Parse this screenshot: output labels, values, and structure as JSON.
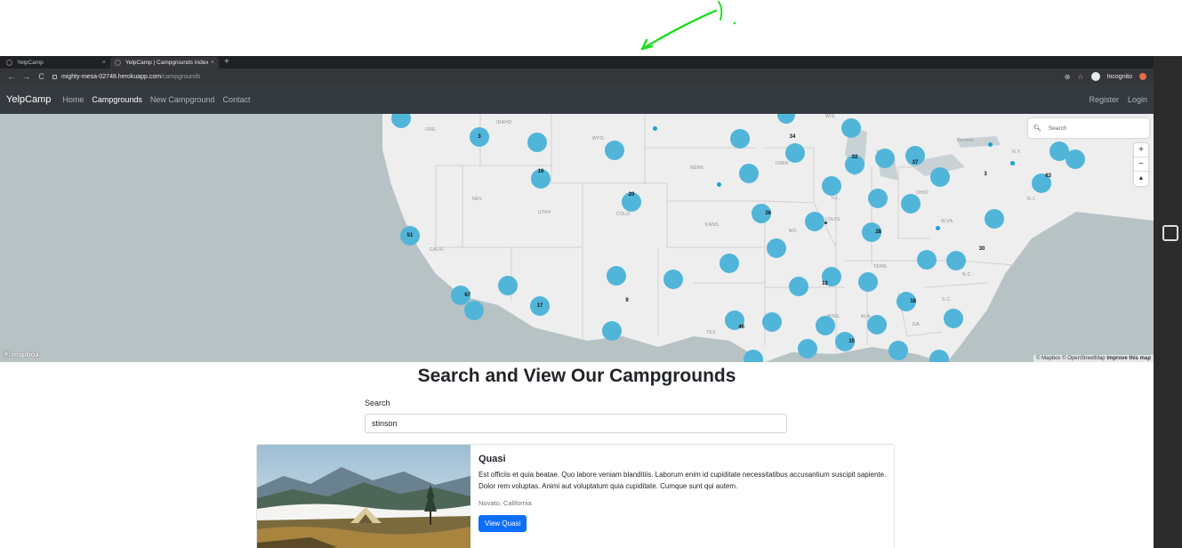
{
  "browser": {
    "tabs": [
      {
        "title": "YelpCamp",
        "close": "×"
      },
      {
        "title": "YelpCamp | Campgrounds Index",
        "close": "×"
      }
    ],
    "new_tab": "+",
    "url_host": "mighty-mesa-02748.herokuapp.com",
    "url_path": "/campgrounds",
    "profile_label": "Incognito"
  },
  "navbar": {
    "brand": "YelpCamp",
    "links": [
      "Home",
      "Campgrounds",
      "New Campground",
      "Contact"
    ],
    "active_link": "Campgrounds",
    "right_links": [
      "Register",
      "Login"
    ]
  },
  "map": {
    "search_placeholder": "Search",
    "zoom_in": "+",
    "zoom_out": "−",
    "compass": "▲",
    "logo": "mapbox",
    "attribution": [
      "© Mapbox",
      "© OpenStreetMap",
      "Improve this map"
    ],
    "state_labels": [
      "IDAHO",
      "ORE.",
      "WYO.",
      "NEV.",
      "UTAH",
      "COLO.",
      "CALIF.",
      "NEBR.",
      "IOWA",
      "KANS.",
      "MO.",
      "ILL.",
      "OHIO",
      "W.VA.",
      "TENN.",
      "N.C.",
      "S.C.",
      "GA.",
      "ALA.",
      "MISS.",
      "TEX.",
      "WIS.",
      "N.Y.",
      "N.J.",
      "Toronto",
      "LOUIS"
    ],
    "cluster_counts": [
      "3",
      "16",
      "20",
      "51",
      "67",
      "17",
      "9",
      "34",
      "32",
      "37",
      "3",
      "63",
      "26",
      "28",
      "30",
      "13",
      "18",
      "46",
      "15",
      "3"
    ],
    "cluster_color": "#51b5d9",
    "point_color": "#1c9fd8"
  },
  "page": {
    "title": "Search and View Our Campgrounds",
    "search_label": "Search",
    "search_value": "stinson"
  },
  "campground": {
    "title": "Quasi",
    "description": "Est officiis et quia beatae. Quo labore veniam blanditiis. Laborum enim id cupiditate necessitatibus accusantium suscipit sapiente. Dolor rem voluptas. Animi aut voluptatum quia cupiditate. Cumque sunt qui autem.",
    "location": "Novato, California",
    "button_label": "View Quasi"
  },
  "colors": {
    "navbar_bg": "#343a40",
    "primary_button": "#0d6efd",
    "annotation_arrow": "#22dd22"
  }
}
